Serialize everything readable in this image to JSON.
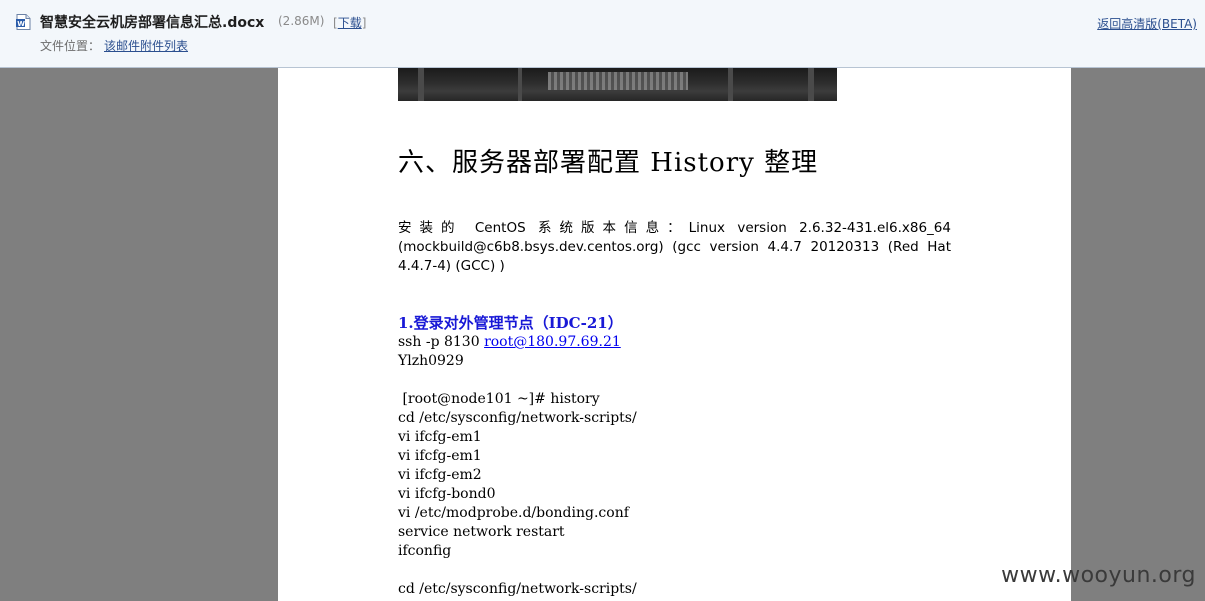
{
  "header": {
    "filename": "智慧安全云机房部署信息汇总.docx",
    "filesize": "(2.86M)",
    "download_label": "下载",
    "location_label": "文件位置：",
    "location_link": "该邮件附件列表",
    "hd_link": "返回高清版(BETA)"
  },
  "document": {
    "heading": "六、服务器部署配置 History 整理",
    "info": "安装的 CentOS 系统版本信息：Linux version 2.6.32-431.el6.x86_64 (mockbuild@c6b8.bsys.dev.centos.org) (gcc version 4.4.7 20120313 (Red Hat 4.4.7-4) (GCC) )",
    "section_title": "1.登录对外管理节点（IDC-21）",
    "ssh_prefix": "ssh -p 8130 ",
    "ssh_link": "root@180.97.69.21",
    "password": "Ylzh0929",
    "lines": [
      " [root@node101 ~]# history",
      "cd /etc/sysconfig/network-scripts/",
      "vi ifcfg-em1",
      "vi ifcfg-em1",
      "vi ifcfg-em2",
      "vi ifcfg-bond0",
      "vi /etc/modprobe.d/bonding.conf",
      "service network restart",
      "ifconfig",
      "",
      "cd /etc/sysconfig/network-scripts/"
    ]
  },
  "watermark": "www.wooyun.org",
  "icons": {
    "doc": "word-document-icon"
  }
}
